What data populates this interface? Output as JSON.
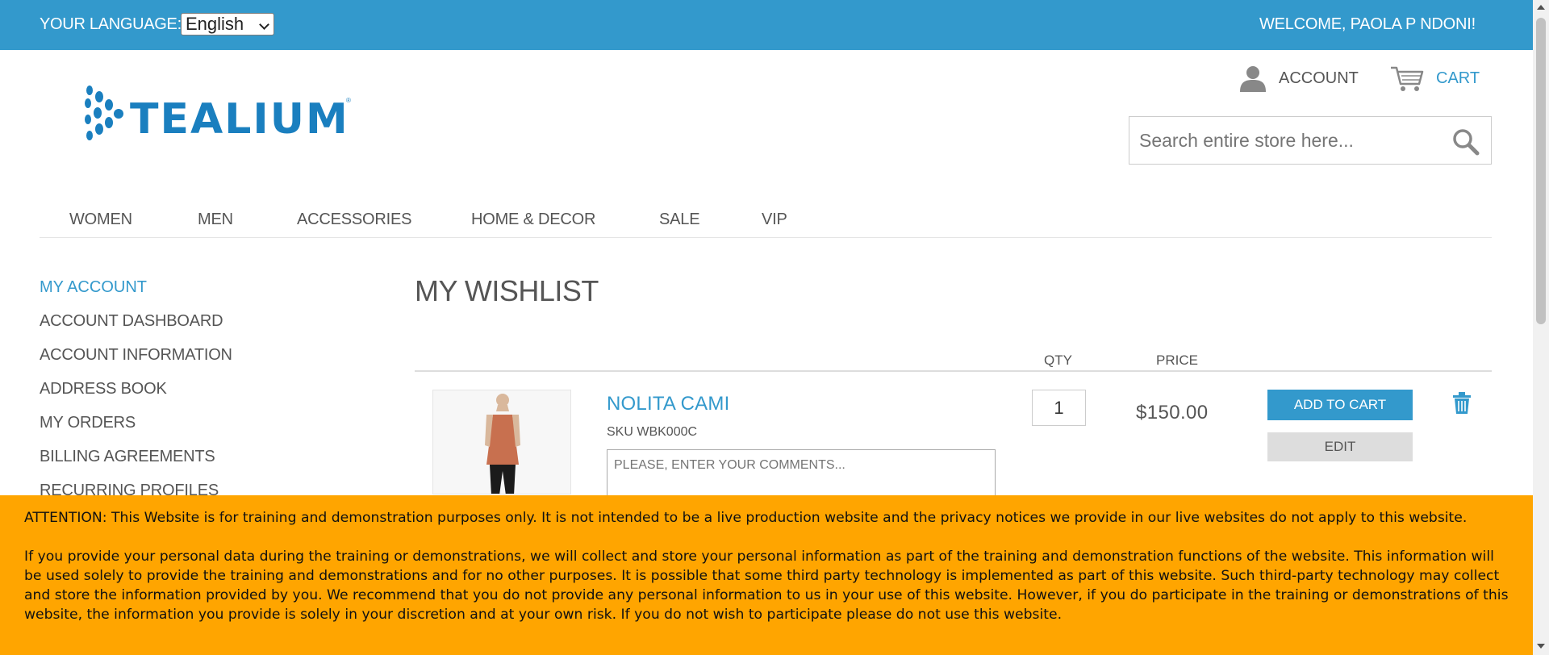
{
  "topbar": {
    "language_label": "YOUR LANGUAGE:",
    "language_selected": "English",
    "welcome": "WELCOME, PAOLA P NDONI!"
  },
  "header": {
    "logo_text": "TEALIUM",
    "logo_tm": "®",
    "account_label": "ACCOUNT",
    "cart_label": "CART",
    "search_placeholder": "Search entire store here..."
  },
  "nav": {
    "items": [
      "WOMEN",
      "MEN",
      "ACCESSORIES",
      "HOME & DECOR",
      "SALE",
      "VIP"
    ]
  },
  "sidebar": {
    "title": "MY ACCOUNT",
    "items": [
      "ACCOUNT DASHBOARD",
      "ACCOUNT INFORMATION",
      "ADDRESS BOOK",
      "MY ORDERS",
      "BILLING AGREEMENTS",
      "RECURRING PROFILES"
    ]
  },
  "main": {
    "title": "MY WISHLIST",
    "columns": {
      "qty": "QTY",
      "price": "PRICE"
    },
    "item": {
      "name": "NOLITA CAMI",
      "sku": "SKU WBK000C",
      "comment_placeholder": "PLEASE, ENTER YOUR COMMENTS...",
      "qty": "1",
      "price": "$150.00",
      "add_to_cart": "ADD TO CART",
      "edit": "EDIT"
    }
  },
  "banner": {
    "paragraph1": "ATTENTION: This Website is for training and demonstration purposes only. It is not intended to be a live production website and the privacy notices we provide in our live websites do not apply to this website.",
    "paragraph2": "If you provide your personal data during the training or demonstrations, we will collect and store your personal information as part of the training and demonstration functions of the website. This information will be used solely to provide the training and demonstrations and for no other purposes. It is possible that some third party technology is implemented as part of this website. Such third-party technology may collect and store the information provided by you. We recommend that you do not provide any personal information to us in your use of this website. However, if you do participate in the training or demonstrations of this website, the information you provide is solely in your discretion and at your own risk. If you do not wish to participate please do not use this website."
  },
  "colors": {
    "brand_blue": "#3399cc",
    "banner_orange": "#ffa500",
    "logo_blue": "#1a7fbf"
  }
}
